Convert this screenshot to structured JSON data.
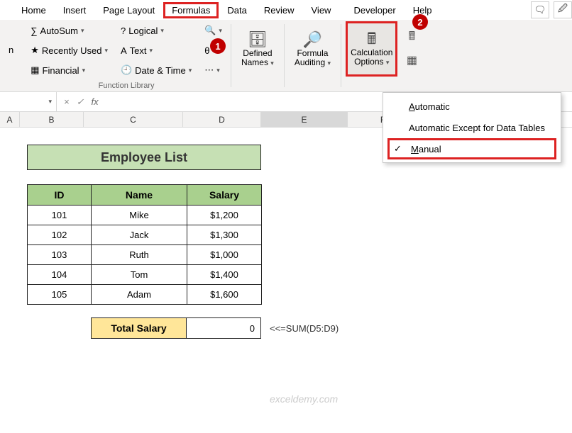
{
  "tabs": [
    "Home",
    "Insert",
    "Page Layout",
    "Formulas",
    "Data",
    "Review",
    "View",
    "Developer",
    "Help"
  ],
  "active_tab": "Formulas",
  "ribbon": {
    "fnlib": {
      "autosum": "AutoSum",
      "recent": "Recently Used",
      "financial": "Financial",
      "logical": "Logical",
      "text": "Text",
      "datetime": "Date & Time",
      "label": "Function Library"
    },
    "names": {
      "label1": "Defined",
      "label2": "Names"
    },
    "audit": {
      "label1": "Formula",
      "label2": "Auditing"
    },
    "calc": {
      "label1": "Calculation",
      "label2": "Options"
    }
  },
  "badges": {
    "b1": "1",
    "b2": "2"
  },
  "dropdown": {
    "auto": "Automatic",
    "auto_ex": "Automatic Except for Data Tables",
    "manual": "Manual",
    "check": "✓"
  },
  "fbar": {
    "name": "",
    "fx": "fx",
    "value": ""
  },
  "cols": [
    "A",
    "B",
    "C",
    "D",
    "E",
    "F"
  ],
  "title": "Employee List",
  "headers": {
    "id": "ID",
    "name": "Name",
    "salary": "Salary"
  },
  "rows": [
    {
      "id": "101",
      "name": "Mike",
      "salary": "$1,200"
    },
    {
      "id": "102",
      "name": "Jack",
      "salary": "$1,300"
    },
    {
      "id": "103",
      "name": "Ruth",
      "salary": "$1,000"
    },
    {
      "id": "104",
      "name": "Tom",
      "salary": "$1,400"
    },
    {
      "id": "105",
      "name": "Adam",
      "salary": "$1,600"
    }
  ],
  "total": {
    "label": "Total Salary",
    "value": "0",
    "formula": "<<=SUM(D5:D9)"
  },
  "watermark": "exceldemy.com",
  "chart_data": {
    "type": "table",
    "title": "Employee List",
    "columns": [
      "ID",
      "Name",
      "Salary"
    ],
    "rows": [
      [
        101,
        "Mike",
        1200
      ],
      [
        102,
        "Jack",
        1300
      ],
      [
        103,
        "Ruth",
        1000
      ],
      [
        104,
        "Tom",
        1400
      ],
      [
        105,
        "Adam",
        1600
      ]
    ],
    "total_salary": 0,
    "total_formula": "=SUM(D5:D9)"
  }
}
